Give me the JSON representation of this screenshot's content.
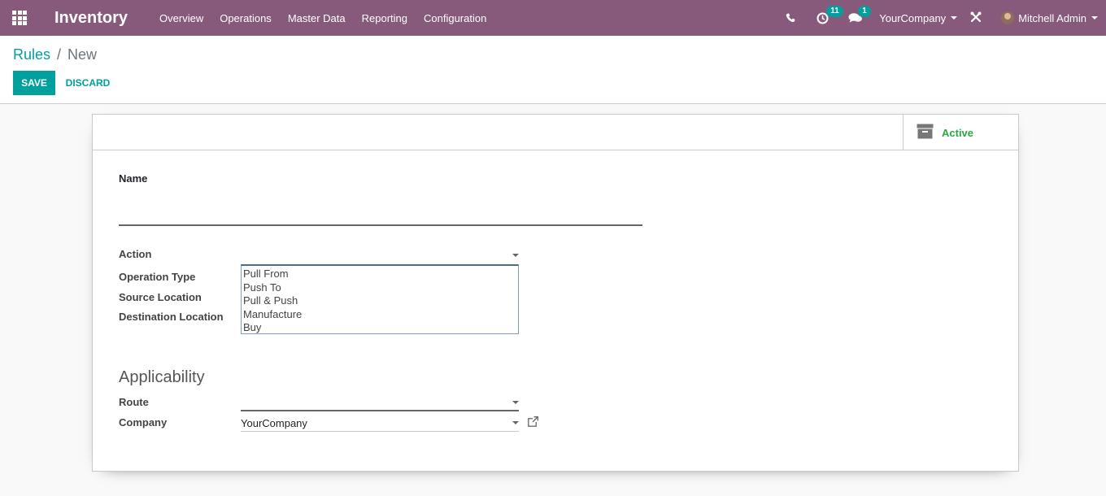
{
  "navbar": {
    "app_name": "Inventory",
    "menu": [
      "Overview",
      "Operations",
      "Master Data",
      "Reporting",
      "Configuration"
    ],
    "activity_count": "11",
    "message_count": "1",
    "company": "YourCompany",
    "user": "Mitchell Admin",
    "icons": {
      "apps": "apps-grid-icon",
      "phone": "phone-icon",
      "activity": "clock-icon",
      "messages": "chat-icon",
      "debug": "debug-tools-icon"
    },
    "color": "#875a7b"
  },
  "breadcrumb": {
    "parent": "Rules",
    "separator": "/",
    "current": "New"
  },
  "buttons": {
    "save": "SAVE",
    "discard": "DISCARD"
  },
  "form": {
    "active_label": "Active",
    "name_label": "Name",
    "name_value": "",
    "action_label": "Action",
    "action_value": "",
    "action_options": [
      "Pull From",
      "Push To",
      "Pull & Push",
      "Manufacture",
      "Buy"
    ],
    "operation_type_label": "Operation Type",
    "source_location_label": "Source Location",
    "destination_location_label": "Destination Location",
    "applicability_title": "Applicability",
    "route_label": "Route",
    "route_value": "",
    "company_label": "Company",
    "company_value": "YourCompany"
  },
  "colors": {
    "primary": "#00a09d",
    "active": "#28a745"
  }
}
